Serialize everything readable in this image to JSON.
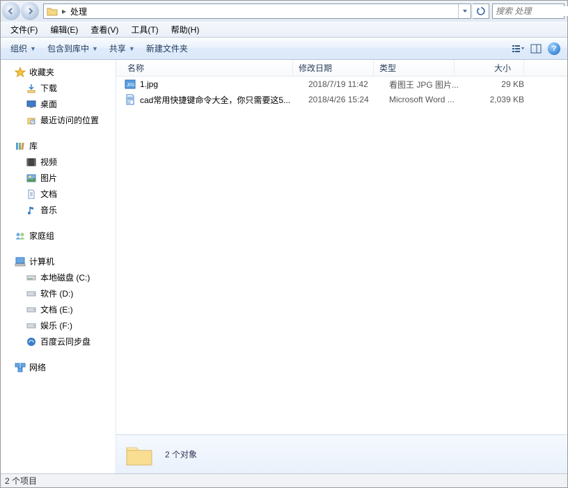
{
  "path": {
    "folder_name": "处理"
  },
  "search": {
    "placeholder": "搜索 处理"
  },
  "menubar": {
    "file": "文件(F)",
    "edit": "编辑(E)",
    "view": "查看(V)",
    "tools": "工具(T)",
    "help": "帮助(H)"
  },
  "toolbar": {
    "organize": "组织",
    "include": "包含到库中",
    "share": "共享",
    "newfolder": "新建文件夹"
  },
  "columns": {
    "name": "名称",
    "date": "修改日期",
    "type": "类型",
    "size": "大小"
  },
  "files": [
    {
      "name": "1.jpg",
      "date": "2018/7/19 11:42",
      "type": "看图王 JPG 图片...",
      "size": "29 KB",
      "icon": "jpg"
    },
    {
      "name": "cad常用快捷键命令大全，你只需要这5...",
      "date": "2018/4/26 15:24",
      "type": "Microsoft Word ...",
      "size": "2,039 KB",
      "icon": "doc"
    }
  ],
  "sidebar": {
    "favorites": {
      "label": "收藏夹",
      "items": [
        "下载",
        "桌面",
        "最近访问的位置"
      ]
    },
    "libraries": {
      "label": "库",
      "items": [
        "视频",
        "图片",
        "文档",
        "音乐"
      ]
    },
    "homegroup": {
      "label": "家庭组"
    },
    "computer": {
      "label": "计算机",
      "items": [
        "本地磁盘 (C:)",
        "软件 (D:)",
        "文档 (E:)",
        "娱乐 (F:)",
        "百度云同步盘"
      ]
    },
    "network": {
      "label": "网络"
    }
  },
  "details": {
    "count": "2 个对象"
  },
  "statusbar": {
    "text": "2 个项目"
  }
}
